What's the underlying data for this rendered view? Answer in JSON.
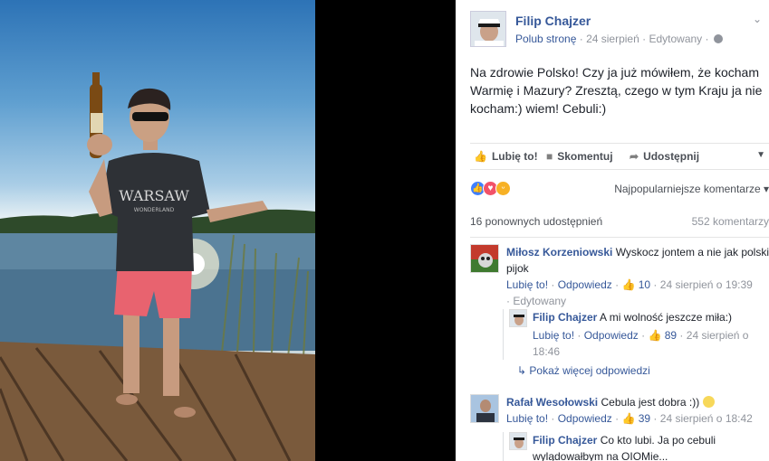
{
  "post": {
    "author": "Filip Chajzer",
    "follow_label": "Polub stronę",
    "date": "24 sierpień",
    "edited": "Edytowany",
    "text": "Na zdrowie Polsko! Czy ja już mówiłem, że kocham Warmię i Mazury? Zresztą, czego w tym Kraju ja nie kocham:) wiem! Cebuli:)",
    "shirt_text": "WARSAW",
    "shirt_subtext": "WONDERLAND"
  },
  "actions": {
    "like": "Lubię to!",
    "comment": "Skomentuj",
    "share": "Udostępnij"
  },
  "reactions": {
    "sort_label": "Najpopularniejsze komentarze",
    "icons": [
      "like-reaction",
      "love-reaction",
      "haha-reaction"
    ],
    "colors": {
      "like": "#4080ff",
      "love": "#f25268",
      "haha": "#f7b125"
    }
  },
  "stats": {
    "shares": "16 ponownych udostępnień",
    "comments": "552 komentarzy"
  },
  "comments": [
    {
      "author": "Miłosz Korzeniowski",
      "text": "Wyskocz jontem a nie jak polski pijok",
      "like": "Lubię to!",
      "reply": "Odpowiedz",
      "likes": "10",
      "date": "24 sierpień o 19:39",
      "edited": "Edytowany",
      "replies": [
        {
          "author": "Filip Chajzer",
          "text": "A mi wolność jeszcze miła:)",
          "like": "Lubię to!",
          "reply": "Odpowiedz",
          "likes": "89",
          "date": "24 sierpień o 18:46"
        }
      ],
      "more_replies": "Pokaż więcej odpowiedzi"
    },
    {
      "author": "Rafał Wesołowski",
      "text": "Cebula jest dobra :))",
      "like": "Lubię to!",
      "reply": "Odpowiedz",
      "likes": "39",
      "date": "24 sierpień o 18:42",
      "replies": [
        {
          "author": "Filip Chajzer",
          "text": "Co kto lubi. Ja po cebuli wylądowałbym na OIOMie..."
        }
      ]
    }
  ]
}
